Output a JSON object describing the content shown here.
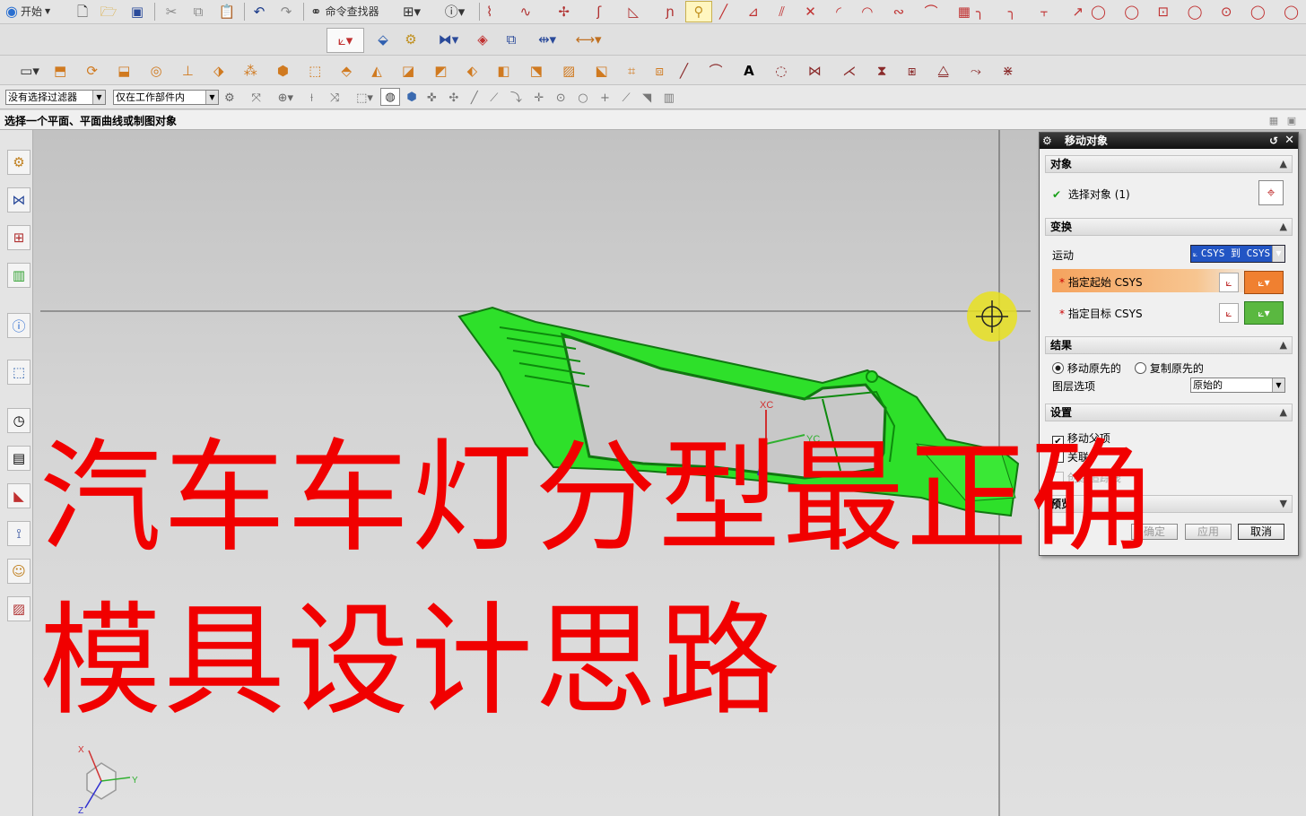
{
  "toolbar_row1": {
    "start_label": "开始",
    "command_finder_label": "命令查找器"
  },
  "selection_bar": {
    "filter_value": "没有选择过滤器",
    "scope_value": "仅在工作部件内"
  },
  "status_prompt": "选择一个平面、平面曲线或制图对象",
  "dialog": {
    "title": "移动对象",
    "sections": {
      "object": "对象",
      "transform": "变换",
      "result": "结果",
      "settings": "设置",
      "preview": "预览"
    },
    "select_object_label": "选择对象 (1)",
    "motion_label": "运动",
    "motion_value": "CSYS 到 CSYS",
    "start_csys_label": "指定起始 CSYS",
    "target_csys_label": "指定目标 CSYS",
    "move_original_label": "移动原先的",
    "copy_original_label": "复制原先的",
    "layer_option_label": "图层选项",
    "layer_option_value": "原始的",
    "move_parent_label": "移动父项",
    "associative_label": "关联",
    "create_trace_label": "创建追踪线",
    "ok_label": "确定",
    "apply_label": "应用",
    "cancel_label": "取消",
    "move_original_selected": true,
    "move_parent_checked": true
  },
  "overlay_text": {
    "line1": "汽车车灯分型最正确",
    "line2": "模具设计思路"
  },
  "viewport": {
    "xc_label": "XC",
    "yc_label": "YC",
    "triad_x": "X",
    "triad_y": "Y",
    "triad_z": "Z"
  },
  "colors": {
    "part_green": "#2ee02a",
    "overlay_red": "#f10000",
    "highlight_orange": "#f5a35e",
    "title_bar": "#1e1e1e",
    "cursor_yellow": "#e8e020"
  }
}
